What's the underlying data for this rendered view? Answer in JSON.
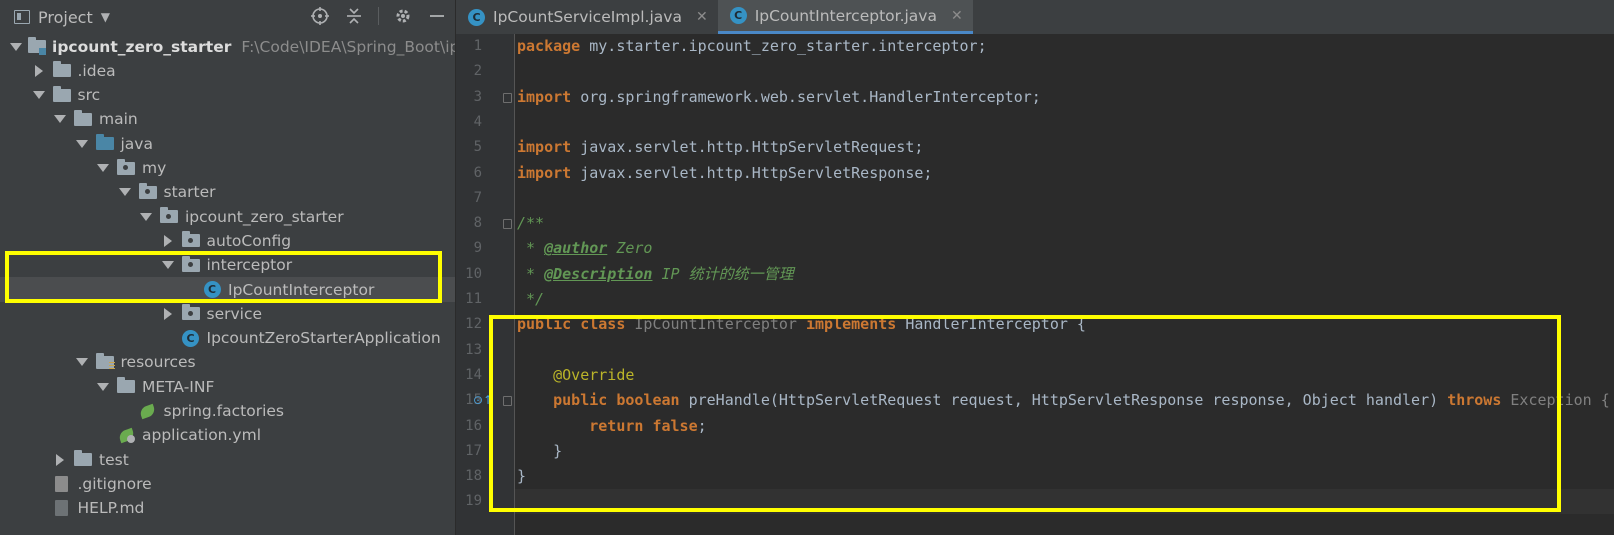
{
  "project_panel": {
    "title": "Project",
    "tree": [
      {
        "label": "ipcount_zero_starter",
        "path": "F:\\Code\\IDEA\\Spring_Boot\\ipcou",
        "depth": 0,
        "expanded": true,
        "icon": "module-folder-icon",
        "bold": true
      },
      {
        "label": ".idea",
        "depth": 1,
        "expanded": false,
        "icon": "folder-icon"
      },
      {
        "label": "src",
        "depth": 1,
        "expanded": true,
        "icon": "folder-icon"
      },
      {
        "label": "main",
        "depth": 2,
        "expanded": true,
        "icon": "folder-icon"
      },
      {
        "label": "java",
        "depth": 3,
        "expanded": true,
        "icon": "source-folder-icon"
      },
      {
        "label": "my",
        "depth": 4,
        "expanded": true,
        "icon": "package-icon"
      },
      {
        "label": "starter",
        "depth": 5,
        "expanded": true,
        "icon": "package-icon"
      },
      {
        "label": "ipcount_zero_starter",
        "depth": 6,
        "expanded": true,
        "icon": "package-icon"
      },
      {
        "label": "autoConfig",
        "depth": 7,
        "expanded": false,
        "icon": "package-icon"
      },
      {
        "label": "interceptor",
        "depth": 7,
        "expanded": true,
        "icon": "package-icon"
      },
      {
        "label": "IpCountInterceptor",
        "depth": 8,
        "leaf": true,
        "icon": "class-icon",
        "selected": true
      },
      {
        "label": "service",
        "depth": 7,
        "expanded": false,
        "icon": "package-icon"
      },
      {
        "label": "IpcountZeroStarterApplication",
        "depth": 7,
        "leaf": true,
        "icon": "spring-boot-class-icon"
      },
      {
        "label": "resources",
        "depth": 3,
        "expanded": true,
        "icon": "resources-folder-icon"
      },
      {
        "label": "META-INF",
        "depth": 4,
        "expanded": true,
        "icon": "folder-icon"
      },
      {
        "label": "spring.factories",
        "depth": 5,
        "leaf": true,
        "icon": "spring-leaf-icon"
      },
      {
        "label": "application.yml",
        "depth": 4,
        "leaf": true,
        "icon": "spring-config-icon"
      },
      {
        "label": "test",
        "depth": 2,
        "expanded": false,
        "icon": "folder-icon"
      },
      {
        "label": ".gitignore",
        "depth": 1,
        "leaf": true,
        "icon": "file-icon"
      },
      {
        "label": "HELP.md",
        "depth": 1,
        "leaf": true,
        "icon": "markdown-file-icon"
      }
    ]
  },
  "editor": {
    "tabs": [
      {
        "label": "IpCountServiceImpl.java",
        "active": false
      },
      {
        "label": "IpCountInterceptor.java",
        "active": true
      }
    ],
    "lines": [
      {
        "n": "1",
        "tokens": [
          [
            "kw",
            "package"
          ],
          [
            "id",
            " my.starter.ipcount_zero_starter.interceptor;"
          ]
        ]
      },
      {
        "n": "2",
        "tokens": []
      },
      {
        "n": "3",
        "tokens": [
          [
            "kw",
            "import"
          ],
          [
            "id",
            " org.springframework.web.servlet.HandlerInterceptor;"
          ]
        ]
      },
      {
        "n": "4",
        "tokens": []
      },
      {
        "n": "5",
        "tokens": [
          [
            "kw",
            "import"
          ],
          [
            "id",
            " javax.servlet.http.HttpServletRequest;"
          ]
        ]
      },
      {
        "n": "6",
        "tokens": [
          [
            "kw",
            "import"
          ],
          [
            "id",
            " javax.servlet.http.HttpServletResponse;"
          ]
        ]
      },
      {
        "n": "7",
        "tokens": []
      },
      {
        "n": "8",
        "tokens": [
          [
            "doc",
            "/**"
          ]
        ]
      },
      {
        "n": "9",
        "tokens": [
          [
            "doc",
            " * "
          ],
          [
            "doc-tag",
            "@author"
          ],
          [
            "doc",
            " Zero"
          ]
        ]
      },
      {
        "n": "10",
        "tokens": [
          [
            "doc",
            " * "
          ],
          [
            "doc-tag",
            "@Description"
          ],
          [
            "doc",
            " IP 统计的统一管理"
          ]
        ]
      },
      {
        "n": "11",
        "tokens": [
          [
            "doc",
            " */"
          ]
        ]
      },
      {
        "n": "12",
        "tokens": [
          [
            "kw",
            "public class"
          ],
          [
            "gray",
            " IpCountInterceptor "
          ],
          [
            "kw",
            "implements"
          ],
          [
            "id",
            " HandlerInterceptor {"
          ]
        ]
      },
      {
        "n": "13",
        "tokens": []
      },
      {
        "n": "14",
        "tokens": [
          [
            "id",
            "    "
          ],
          [
            "ann",
            "@Override"
          ]
        ]
      },
      {
        "n": "15",
        "tokens": [
          [
            "id",
            "    "
          ],
          [
            "kw",
            "public boolean"
          ],
          [
            "id",
            " preHandle(HttpServletRequest request, HttpServletResponse response, Object handler) "
          ],
          [
            "kw",
            "throws"
          ],
          [
            "gray",
            " Exception {"
          ]
        ]
      },
      {
        "n": "16",
        "tokens": [
          [
            "id",
            "        "
          ],
          [
            "kw",
            "return false"
          ],
          [
            "id",
            ";"
          ]
        ]
      },
      {
        "n": "17",
        "tokens": [
          [
            "id",
            "    }"
          ]
        ]
      },
      {
        "n": "18",
        "tokens": [
          [
            "id",
            "}"
          ]
        ]
      },
      {
        "n": "19",
        "tokens": []
      }
    ]
  },
  "colors": {
    "highlight": "#ffff00",
    "keyword": "#cc7832",
    "doc_comment": "#629755",
    "annotation": "#bbb529",
    "selection": "#4b4d4f"
  }
}
